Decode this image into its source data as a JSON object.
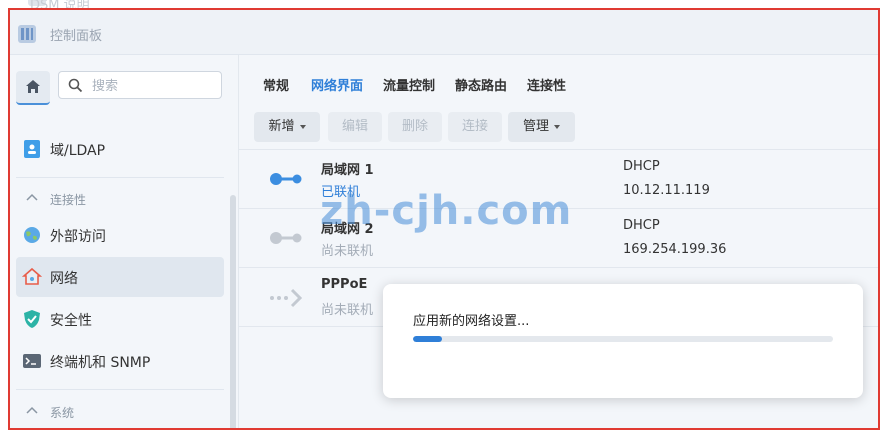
{
  "window": {
    "title": "控制面板",
    "ghost_title": "DSM 说明"
  },
  "sidebar": {
    "search_placeholder": "搜索",
    "items": [
      {
        "label": "域/LDAP",
        "icon": "id-card-icon"
      },
      {
        "label": "外部访问",
        "icon": "globe-icon"
      },
      {
        "label": "网络",
        "icon": "network-home-icon",
        "active": true
      },
      {
        "label": "安全性",
        "icon": "shield-check-icon"
      },
      {
        "label": "终端机和 SNMP",
        "icon": "terminal-icon"
      }
    ],
    "sections": {
      "connectivity": "连接性",
      "system": "系统"
    }
  },
  "tabs": [
    "常规",
    "网络界面",
    "流量控制",
    "静态路由",
    "连接性"
  ],
  "active_tab": "网络界面",
  "toolbar": {
    "create": "新增",
    "edit": "编辑",
    "delete": "删除",
    "connect": "连接",
    "manage": "管理"
  },
  "interfaces": [
    {
      "name": "局域网 1",
      "status": "已联机",
      "mode": "DHCP",
      "ip": "10.12.11.119"
    },
    {
      "name": "局域网 2",
      "status": "尚未联机",
      "mode": "DHCP",
      "ip": "169.254.199.36"
    },
    {
      "name": "PPPoE",
      "status": "尚未联机"
    }
  ],
  "watermark": "zh-cjh.com",
  "dialog": {
    "message": "应用新的网络设置...",
    "progress": 0.07
  },
  "colors": {
    "accent": "#2f7fd8",
    "frame": "#e03a32"
  }
}
